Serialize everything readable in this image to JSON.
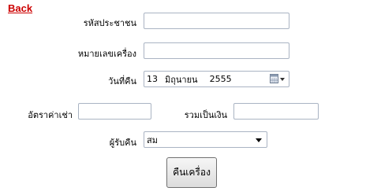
{
  "back_link": "Back",
  "form": {
    "customer_id_label": "รหัสประชาชน",
    "customer_id_value": "",
    "machine_no_label": "หมายเลขเครื่อง",
    "machine_no_value": "",
    "return_date_label": "วันที่คืน",
    "return_date": {
      "day": "13",
      "month": "มิถุนายน",
      "year": "2555"
    },
    "rent_rate_label": "อัตราค่าเช่า",
    "rent_rate_value": "",
    "total_label": "รวมเป็นเงิน",
    "total_value": "",
    "receiver_label": "ผู้รับคืน",
    "receiver_value": "สม"
  },
  "submit_button": "คืนเครื่อง",
  "icons": {
    "calendar": "calendar-icon",
    "dropdown": "chevron-down-icon"
  }
}
